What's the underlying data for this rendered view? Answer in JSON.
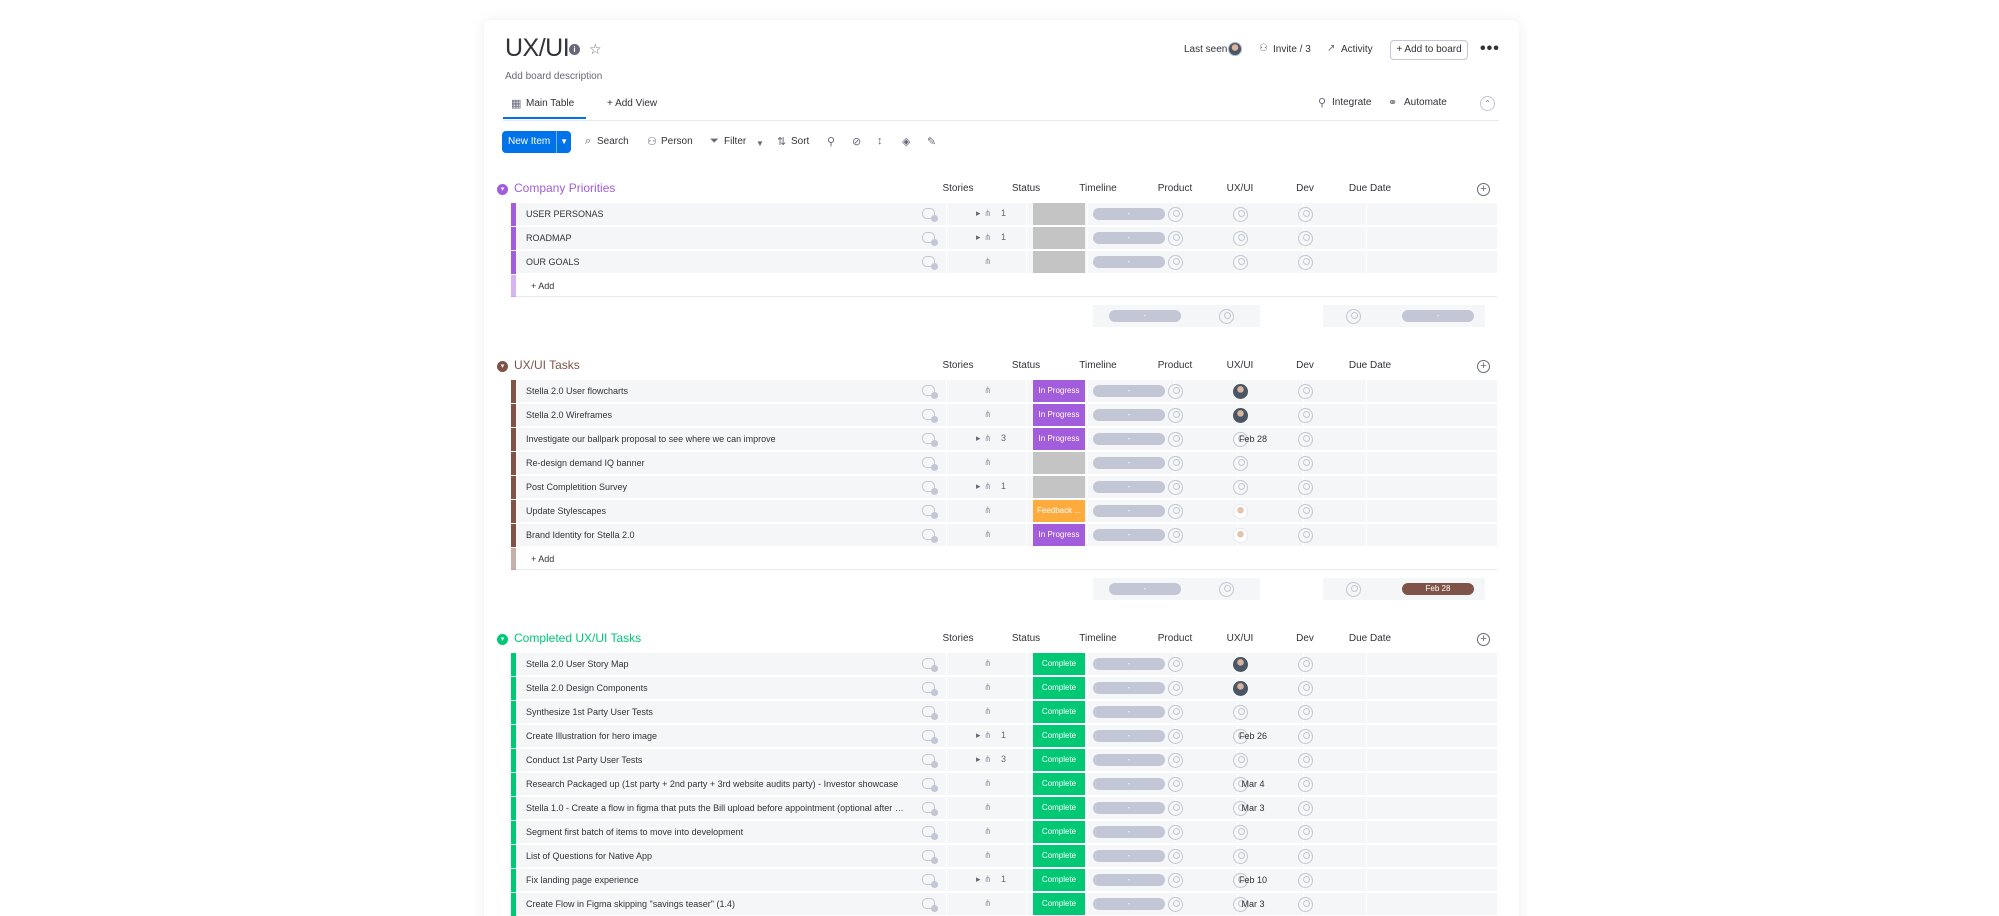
{
  "board": {
    "title": "UX/UI",
    "description": "Add board description",
    "last_seen_label": "Last seen",
    "invite_label": "Invite / 3",
    "activity_label": "Activity",
    "add_to_board_label": "+ Add to board",
    "more_label": "•••"
  },
  "tabs": {
    "main": "Main Table",
    "add_view": "+ Add View",
    "integrate": "Integrate",
    "automate": "Automate"
  },
  "toolbar": {
    "new_item": "New Item",
    "search": "Search",
    "person": "Person",
    "filter": "Filter",
    "sort": "Sort"
  },
  "columns": {
    "stories": "Stories",
    "status": "Status",
    "timeline": "Timeline",
    "product": "Product",
    "uxui": "UX/UI",
    "dev": "Dev",
    "due": "Due Date"
  },
  "colors": {
    "accent_blue": "#0073ea",
    "in_progress": "#a25ddc",
    "complete": "#00c875",
    "feedback": "#fdab3d",
    "empty_status": "#c4c4c4",
    "group_priorities": "#a25ddc",
    "group_tasks": "#7f5347",
    "group_completed": "#00c875",
    "due_pill": "#7f5347"
  },
  "groups": [
    {
      "title": "Company Priorities",
      "color": "#a25ddc",
      "add_label": "+ Add",
      "summary_due": "",
      "rows": [
        {
          "name": "USER PERSONAS",
          "stories": "1",
          "status": "",
          "timeline": "-",
          "uxui": "none",
          "due": ""
        },
        {
          "name": "ROADMAP",
          "stories": "1",
          "status": "",
          "timeline": "-",
          "uxui": "none",
          "due": ""
        },
        {
          "name": "OUR GOALS",
          "stories": "",
          "status": "",
          "timeline": "-",
          "uxui": "none",
          "due": ""
        }
      ]
    },
    {
      "title": "UX/UI Tasks",
      "color": "#7f5347",
      "add_label": "+ Add",
      "summary_due": "Feb 28",
      "rows": [
        {
          "name": "Stella 2.0 User flowcharts",
          "stories": "",
          "status": "In Progress",
          "timeline": "-",
          "uxui": "photo",
          "due": ""
        },
        {
          "name": "Stella 2.0 Wireframes",
          "stories": "",
          "status": "In Progress",
          "timeline": "-",
          "uxui": "photo",
          "due": ""
        },
        {
          "name": "Investigate our ballpark proposal to see where we can improve",
          "stories": "3",
          "status": "In Progress",
          "timeline": "-",
          "uxui": "none",
          "due": "Feb 28"
        },
        {
          "name": "Re-design demand IQ banner",
          "stories": "",
          "status": "",
          "timeline": "-",
          "uxui": "none",
          "due": ""
        },
        {
          "name": "Post Completition Survey",
          "stories": "1",
          "status": "",
          "timeline": "-",
          "uxui": "none",
          "due": ""
        },
        {
          "name": "Update Stylescapes",
          "stories": "",
          "status": "Feedback ...",
          "timeline": "-",
          "uxui": "photo-light",
          "due": ""
        },
        {
          "name": "Brand Identity for Stella 2.0",
          "stories": "",
          "status": "In Progress",
          "timeline": "-",
          "uxui": "photo-light",
          "due": ""
        }
      ]
    },
    {
      "title": "Completed UX/UI Tasks",
      "color": "#00c875",
      "rows": [
        {
          "name": "Stella 2.0 User Story Map",
          "stories": "",
          "status": "Complete",
          "timeline": "-",
          "uxui": "photo",
          "due": ""
        },
        {
          "name": "Stella 2.0 Design Components",
          "stories": "",
          "status": "Complete",
          "timeline": "-",
          "uxui": "photo",
          "due": ""
        },
        {
          "name": "Synthesize 1st Party User Tests",
          "stories": "",
          "status": "Complete",
          "timeline": "-",
          "uxui": "none",
          "due": ""
        },
        {
          "name": "Create Illustration for hero image",
          "stories": "1",
          "status": "Complete",
          "timeline": "-",
          "uxui": "none",
          "due": "Feb 26"
        },
        {
          "name": "Conduct 1st Party User Tests",
          "stories": "3",
          "status": "Complete",
          "timeline": "-",
          "uxui": "none",
          "due": ""
        },
        {
          "name": "Research Packaged up (1st party + 2nd party + 3rd website audits party) - Investor showcase",
          "stories": "",
          "status": "Complete",
          "timeline": "-",
          "uxui": "none",
          "due": "Mar 4"
        },
        {
          "name": "Stella 1.0 - Create a flow in figma that puts the Bill upload before appointment (optional after to...",
          "stories": "",
          "status": "Complete",
          "timeline": "-",
          "uxui": "none",
          "due": "Mar 3"
        },
        {
          "name": "Segment first batch of items to move into development",
          "stories": "",
          "status": "Complete",
          "timeline": "-",
          "uxui": "none",
          "due": ""
        },
        {
          "name": "List of Questions for Native App",
          "stories": "",
          "status": "Complete",
          "timeline": "-",
          "uxui": "none",
          "due": ""
        },
        {
          "name": "Fix landing page experience",
          "stories": "1",
          "status": "Complete",
          "timeline": "-",
          "uxui": "none",
          "due": "Feb 10"
        },
        {
          "name": "Create Flow in Figma skipping \"savings teaser\" (1.4)",
          "stories": "",
          "status": "Complete",
          "timeline": "-",
          "uxui": "none",
          "due": "Mar 3"
        }
      ]
    }
  ]
}
